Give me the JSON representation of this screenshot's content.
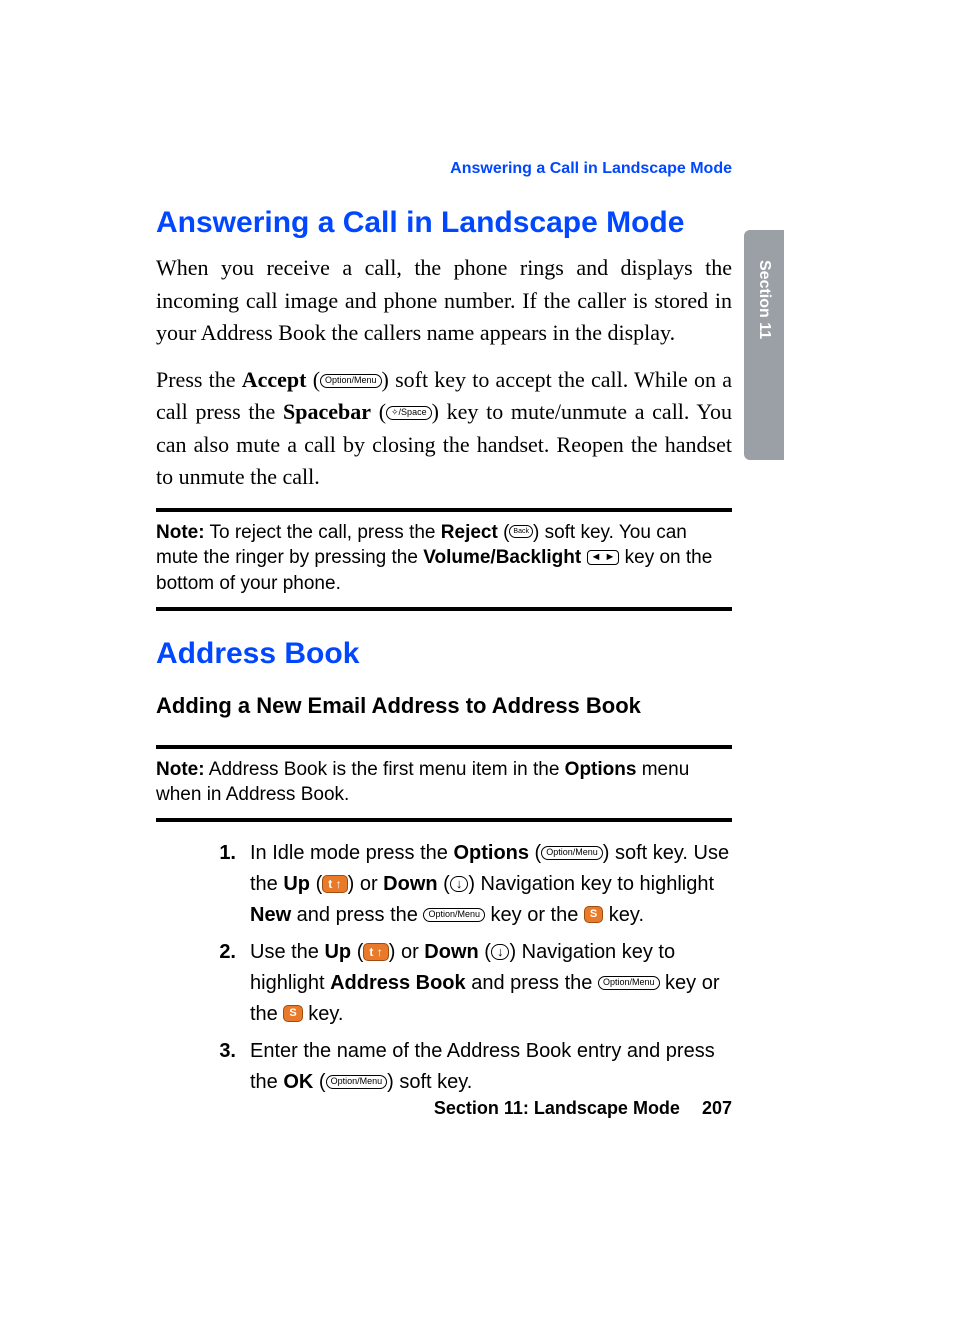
{
  "running_header": "Answering a Call in Landscape Mode",
  "side_tab": "Section 11",
  "h1_a": "Answering a Call in Landscape Mode",
  "p1": "When you receive a call, the phone rings and displays the incoming call image and phone number. If the caller is stored in your Address Book the callers name appears in the display.",
  "p2": {
    "pre_accept": "Press the ",
    "accept": "Accept",
    "after_accept": " soft key to accept the call. While on a call press the ",
    "spacebar": "Spacebar",
    "after_spacebar": " key to mute/unmute a call. You can also mute a call by closing the handset. Reopen the handset to unmute the call."
  },
  "note1": {
    "label": "Note:",
    "t1": " To reject the call, press the ",
    "reject": "Reject",
    "t2": " soft key. You can mute the ringer by pressing the ",
    "vol": "Volume/Backlight",
    "t3": " key on the bottom of your phone."
  },
  "h1_b": "Address Book",
  "h2": "Adding a New Email Address to Address Book",
  "note2": {
    "label": "Note:",
    "t1": " Address Book is the first menu item in the ",
    "opt": "Options",
    "t2": " menu when in Address Book."
  },
  "steps": {
    "s1": {
      "a": "In Idle mode press the ",
      "options": "Options",
      "b": " soft key. Use the ",
      "up": "Up",
      "or": " or ",
      "down": "Down",
      "c": " Navigation key to highlight ",
      "new": "New",
      "d": " and press the ",
      "e": " key or the ",
      "f": " key."
    },
    "s2": {
      "a": "Use the ",
      "up": "Up",
      "or": " or ",
      "down": "Down",
      "b": " Navigation key to highlight ",
      "ab": "Address Book",
      "c": " and press the ",
      "d": " key or the ",
      "e": " key."
    },
    "s3": {
      "a": "Enter the name of the Address Book entry and press the ",
      "ok": "OK",
      "b": " soft key."
    }
  },
  "keys": {
    "option_menu": "Option/Menu",
    "space": "✧/Space",
    "back": "Back",
    "lr": "◄  ►",
    "up_glyph": "t ↑",
    "down_glyph": "↓",
    "s": "S"
  },
  "footer": {
    "section_label": "Section 11: Landscape Mode",
    "page": "207"
  }
}
